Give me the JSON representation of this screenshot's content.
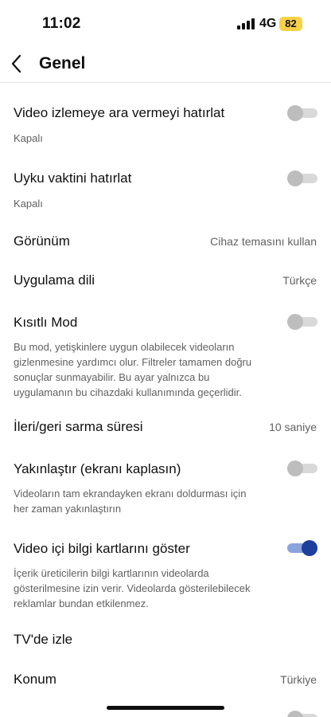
{
  "status_bar": {
    "time": "11:02",
    "network": "4G",
    "battery": "82"
  },
  "header": {
    "title": "Genel"
  },
  "settings": {
    "break_reminder": {
      "title": "Video izlemeye ara vermeyi hatırlat",
      "subtitle": "Kapalı",
      "enabled": false
    },
    "bedtime_reminder": {
      "title": "Uyku vaktini hatırlat",
      "subtitle": "Kapalı",
      "enabled": false
    },
    "appearance": {
      "title": "Görünüm",
      "value": "Cihaz temasını kullan"
    },
    "app_language": {
      "title": "Uygulama dili",
      "value": "Türkçe"
    },
    "restricted_mode": {
      "title": "Kısıtlı Mod",
      "description_lines": [
        "Bu mod, yetişkinlere uygun olabilecek videoların",
        "gizlenmesine yardımcı olur. Filtreler tamamen doğru",
        "sonuçlar sunmayabilir. Bu ayar yalnızca bu",
        "uygulamanın bu cihazdaki kullanımında geçerlidir."
      ],
      "enabled": false
    },
    "seek_duration": {
      "title": "İleri/geri sarma süresi",
      "value": "10 saniye"
    },
    "zoom_to_fill": {
      "title": "Yakınlaştır (ekranı kaplasın)",
      "description_lines": [
        "Videoların tam ekrandayken ekranı doldurması için",
        "her zaman yakınlaştırın"
      ],
      "enabled": false
    },
    "info_cards": {
      "title": "Video içi bilgi kartlarını göster",
      "description_lines": [
        "İçerik üreticilerin bilgi kartlarının videolarda",
        "gösterilmesine izin verir. Videolarda gösterilebilecek",
        "reklamlar bundan etkilenmez."
      ],
      "enabled": true
    },
    "watch_on_tv": {
      "title": "TV'de izle"
    },
    "location": {
      "title": "Konum",
      "value": "Türkiye"
    },
    "partial_row": {
      "enabled": false
    }
  }
}
